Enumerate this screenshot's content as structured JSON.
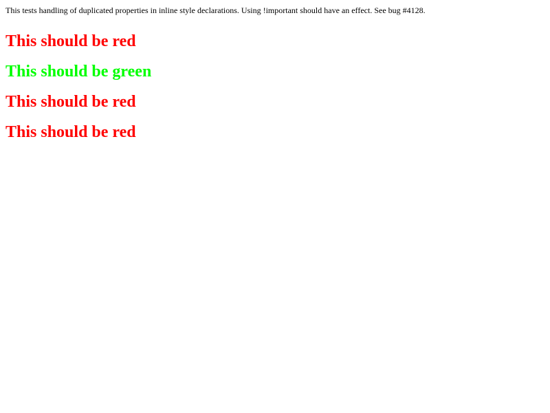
{
  "description": "This tests handling of duplicated properties in inline style declarations. Using !important should have an effect. See bug #4128.",
  "headlines": [
    {
      "text": "This should be red",
      "color": "#ff0000"
    },
    {
      "text": "This should be green",
      "color": "#00ff00"
    },
    {
      "text": "This should be red",
      "color": "#ff0000"
    },
    {
      "text": "This should be red",
      "color": "#ff0000"
    }
  ]
}
